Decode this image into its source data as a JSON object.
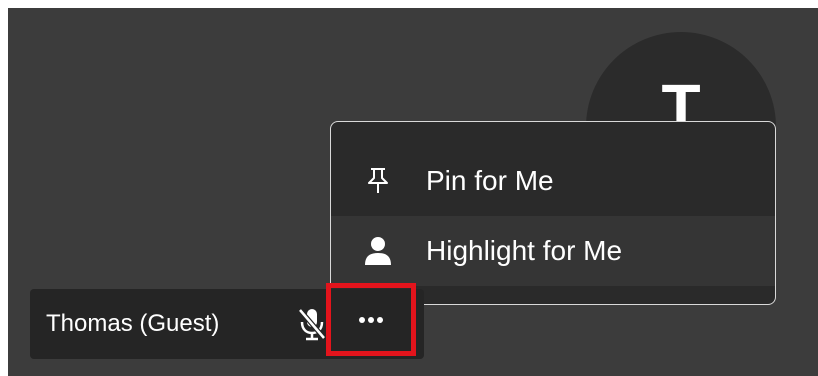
{
  "avatar": {
    "initial": "T"
  },
  "menu": {
    "items": [
      {
        "label": "Pin for Me",
        "icon": "pin-icon"
      },
      {
        "label": "Highlight for Me",
        "icon": "person-icon"
      }
    ]
  },
  "participant": {
    "name": "Thomas (Guest)",
    "mic_icon": "mic-off-icon",
    "more_icon": "more-options-icon"
  },
  "colors": {
    "background": "#3c3c3c",
    "menu_bg": "#2a2a2a",
    "menu_hover": "#353535",
    "name_bar": "#252525",
    "highlight_box": "#e3141c"
  }
}
